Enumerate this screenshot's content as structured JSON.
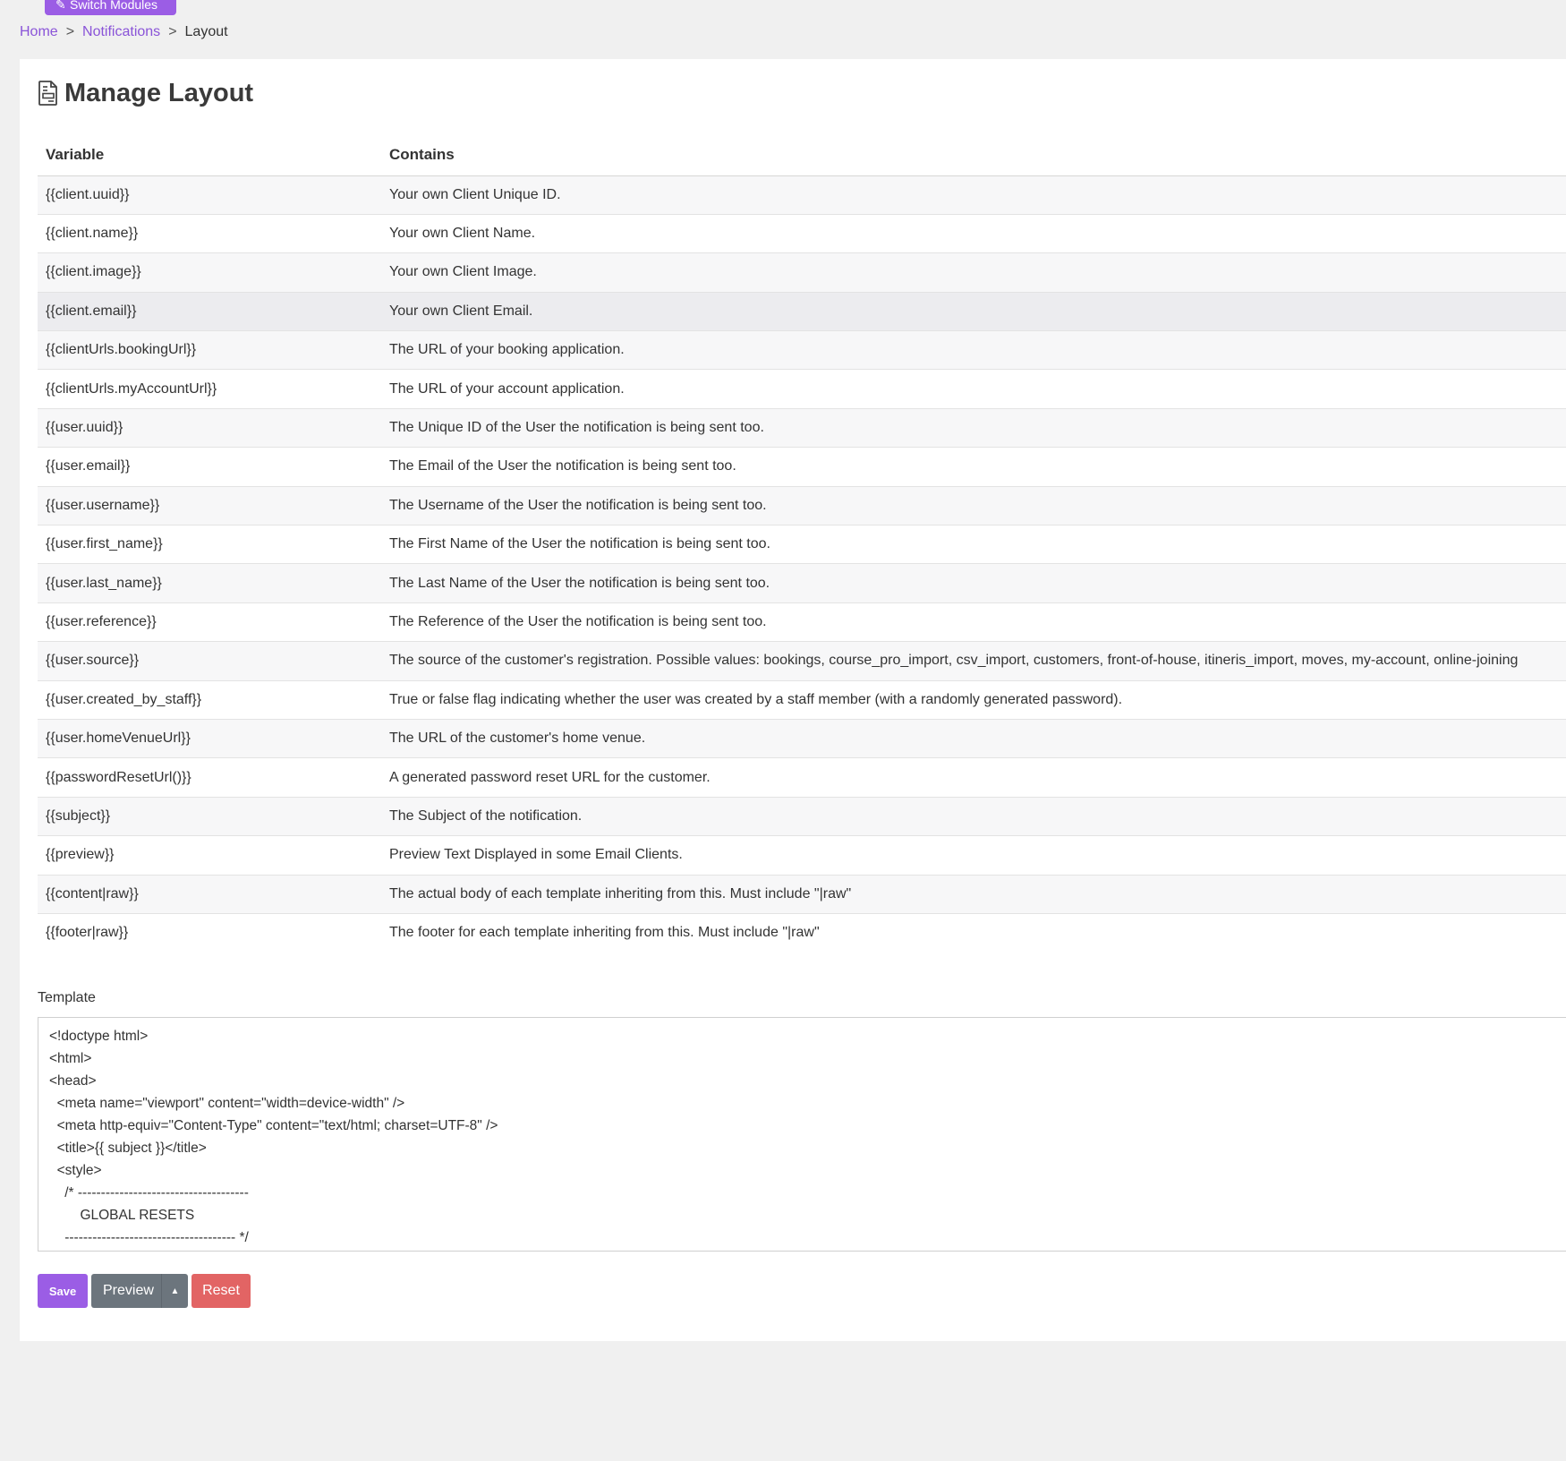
{
  "topbar": {
    "switch_modules_label": "Switch Modules"
  },
  "breadcrumb": {
    "home": "Home",
    "sep1": ">",
    "notifications": "Notifications",
    "sep2": ">",
    "current": "Layout"
  },
  "page": {
    "title": "Manage Layout"
  },
  "table": {
    "headers": [
      "Variable",
      "Contains"
    ],
    "rows": [
      {
        "variable": "{{client.uuid}}",
        "contains": "Your own Client Unique ID."
      },
      {
        "variable": "{{client.name}}",
        "contains": "Your own Client Name."
      },
      {
        "variable": "{{client.image}}",
        "contains": "Your own Client Image."
      },
      {
        "variable": "{{client.email}}",
        "contains": "Your own Client Email."
      },
      {
        "variable": "{{clientUrls.bookingUrl}}",
        "contains": "The URL of your booking application."
      },
      {
        "variable": "{{clientUrls.myAccountUrl}}",
        "contains": "The URL of your account application."
      },
      {
        "variable": "{{user.uuid}}",
        "contains": "The Unique ID of the User the notification is being sent too."
      },
      {
        "variable": "{{user.email}}",
        "contains": "The Email of the User the notification is being sent too."
      },
      {
        "variable": "{{user.username}}",
        "contains": "The Username of the User the notification is being sent too."
      },
      {
        "variable": "{{user.first_name}}",
        "contains": "The First Name of the User the notification is being sent too."
      },
      {
        "variable": "{{user.last_name}}",
        "contains": "The Last Name of the User the notification is being sent too."
      },
      {
        "variable": "{{user.reference}}",
        "contains": "The Reference of the User the notification is being sent too."
      },
      {
        "variable": "{{user.source}}",
        "contains": "The source of the customer's registration. Possible values: bookings, course_pro_import, csv_import, customers, front-of-house, itineris_import, moves, my-account, online-joining"
      },
      {
        "variable": "{{user.created_by_staff}}",
        "contains": "True or false flag indicating whether the user was created by a staff member (with a randomly generated password)."
      },
      {
        "variable": "{{user.homeVenueUrl}}",
        "contains": "The URL of the customer's home venue."
      },
      {
        "variable": "{{passwordResetUrl()}}",
        "contains": "A generated password reset URL for the customer."
      },
      {
        "variable": "{{subject}}",
        "contains": "The Subject of the notification."
      },
      {
        "variable": "{{preview}}",
        "contains": "Preview Text Displayed in some Email Clients."
      },
      {
        "variable": "{{content|raw}}",
        "contains": "The actual body of each template inheriting from this. Must include \"|raw\""
      },
      {
        "variable": "{{footer|raw}}",
        "contains": "The footer for each template inheriting from this. Must include \"|raw\""
      }
    ]
  },
  "template": {
    "label": "Template",
    "value": "<!doctype html>\n<html>\n<head>\n  <meta name=\"viewport\" content=\"width=device-width\" />\n  <meta http-equiv=\"Content-Type\" content=\"text/html; charset=UTF-8\" />\n  <title>{{ subject }}</title>\n  <style>\n    /* -------------------------------------\n        GLOBAL RESETS\n    ------------------------------------- */"
  },
  "actions": {
    "save": "Save",
    "preview": "Preview",
    "reset": "Reset"
  },
  "colors": {
    "accent": "#9b5de5",
    "link": "#8a54d8",
    "secondary": "#6c757d",
    "danger": "#e26464",
    "background": "#f0f0f0"
  },
  "icons": {
    "menu": "hamburger-icon",
    "switch": "edit-icon",
    "title": "document-icon",
    "preview_toggle": "caret-up-icon"
  }
}
